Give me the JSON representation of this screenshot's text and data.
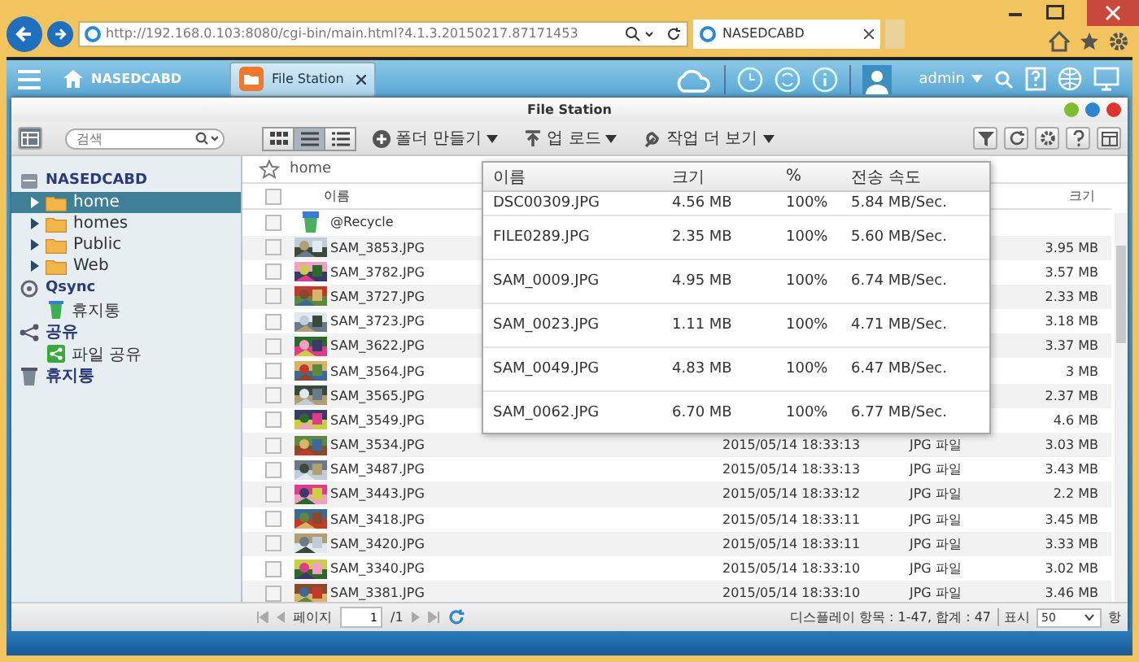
{
  "browser": {
    "url": "http://192.168.0.103:8080/cgi-bin/main.html?4.1.3.20150217.87171453",
    "tab": "NASEDCABD"
  },
  "app_bar": {
    "home_tab": "NASEDCABD",
    "app_tab": "File Station",
    "user": "admin"
  },
  "window": {
    "title": "File Station"
  },
  "toolbar": {
    "search": {
      "placeholder": "검색"
    },
    "views": [
      {
        "selected": false
      },
      {
        "selected": true
      },
      {
        "selected": false
      }
    ],
    "actions": [
      "폴더 만들기",
      "업 로드",
      "작업 더 보기"
    ]
  },
  "sidebar": {
    "items": [
      {
        "label": "NASEDCABD",
        "kind": "server",
        "children": [
          {
            "label": "home",
            "kind": "folder",
            "selected": true
          },
          {
            "label": "homes",
            "kind": "folder",
            "selected": false
          },
          {
            "label": "Public",
            "kind": "folder",
            "selected": false
          },
          {
            "label": "Web",
            "kind": "folder",
            "selected": false
          }
        ]
      },
      {
        "label": "Qsync",
        "kind": "sync",
        "children": [
          {
            "label": "휴지통",
            "kind": "trash",
            "selected": false
          }
        ]
      },
      {
        "label": "공유",
        "kind": "share",
        "children": [
          {
            "label": "파일 공유",
            "kind": "share",
            "selected": false
          }
        ]
      },
      {
        "label": "휴지통",
        "kind": "trash"
      }
    ]
  },
  "breadcrumb": "home",
  "table": {
    "columns": [
      "이름",
      "크기"
    ],
    "all_checked": false,
    "rows": [
      {
        "name": "@Recycle",
        "kind": "recycle",
        "checked": false
      },
      {
        "name": "SAM_3853.JPG",
        "checked": false,
        "size": "3.95 MB"
      },
      {
        "name": "SAM_3782.JPG",
        "checked": false,
        "size": "3.57 MB"
      },
      {
        "name": "SAM_3727.JPG",
        "checked": false,
        "size": "2.33 MB"
      },
      {
        "name": "SAM_3723.JPG",
        "checked": false,
        "size": "3.18 MB"
      },
      {
        "name": "SAM_3622.JPG",
        "checked": false,
        "size": "3.37 MB"
      },
      {
        "name": "SAM_3564.JPG",
        "checked": false,
        "size": "3 MB"
      },
      {
        "name": "SAM_3565.JPG",
        "checked": false,
        "size": "2.37 MB"
      },
      {
        "name": "SAM_3549.JPG",
        "checked": false,
        "size": "4.6 MB"
      },
      {
        "name": "SAM_3534.JPG",
        "checked": false,
        "modified": "2015/05/14 18:33:13",
        "type": "JPG 파일",
        "size": "3.03 MB"
      },
      {
        "name": "SAM_3487.JPG",
        "checked": false,
        "modified": "2015/05/14 18:33:13",
        "type": "JPG 파일",
        "size": "3.43 MB"
      },
      {
        "name": "SAM_3443.JPG",
        "checked": false,
        "modified": "2015/05/14 18:33:12",
        "type": "JPG 파일",
        "size": "2.2 MB"
      },
      {
        "name": "SAM_3418.JPG",
        "checked": false,
        "modified": "2015/05/14 18:33:11",
        "type": "JPG 파일",
        "size": "3.45 MB"
      },
      {
        "name": "SAM_3420.JPG",
        "checked": false,
        "modified": "2015/05/14 18:33:11",
        "type": "JPG 파일",
        "size": "3.33 MB"
      },
      {
        "name": "SAM_3340.JPG",
        "checked": false,
        "modified": "2015/05/14 18:33:10",
        "type": "JPG 파일",
        "size": "3.02 MB"
      },
      {
        "name": "SAM_3381.JPG",
        "checked": false,
        "modified": "2015/05/14 18:33:10",
        "type": "JPG 파일",
        "size": "3.46 MB"
      }
    ]
  },
  "footer": {
    "page_label": "페이지",
    "page": "1",
    "pages": "/1",
    "summary": "디스플레이 항목 : 1-47, 합계 : 47",
    "show_label": "표시",
    "per_page": "50",
    "items_label": "항"
  },
  "transfers": {
    "columns": [
      "이름",
      "크기",
      "%",
      "전송 속도"
    ],
    "rows": [
      {
        "name": "DSC00309.JPG",
        "size": "4.56 MB",
        "percent": "100%",
        "speed": "5.84 MB/Sec."
      },
      {
        "name": "FILE0289.JPG",
        "size": "2.35 MB",
        "percent": "100%",
        "speed": "5.60 MB/Sec."
      },
      {
        "name": "SAM_0009.JPG",
        "size": "4.95 MB",
        "percent": "100%",
        "speed": "6.74 MB/Sec."
      },
      {
        "name": "SAM_0023.JPG",
        "size": "1.11 MB",
        "percent": "100%",
        "speed": "4.71 MB/Sec."
      },
      {
        "name": "SAM_0049.JPG",
        "size": "4.83 MB",
        "percent": "100%",
        "speed": "6.47 MB/Sec."
      },
      {
        "name": "SAM_0062.JPG",
        "size": "6.70 MB",
        "percent": "100%",
        "speed": "6.77 MB/Sec."
      }
    ]
  }
}
